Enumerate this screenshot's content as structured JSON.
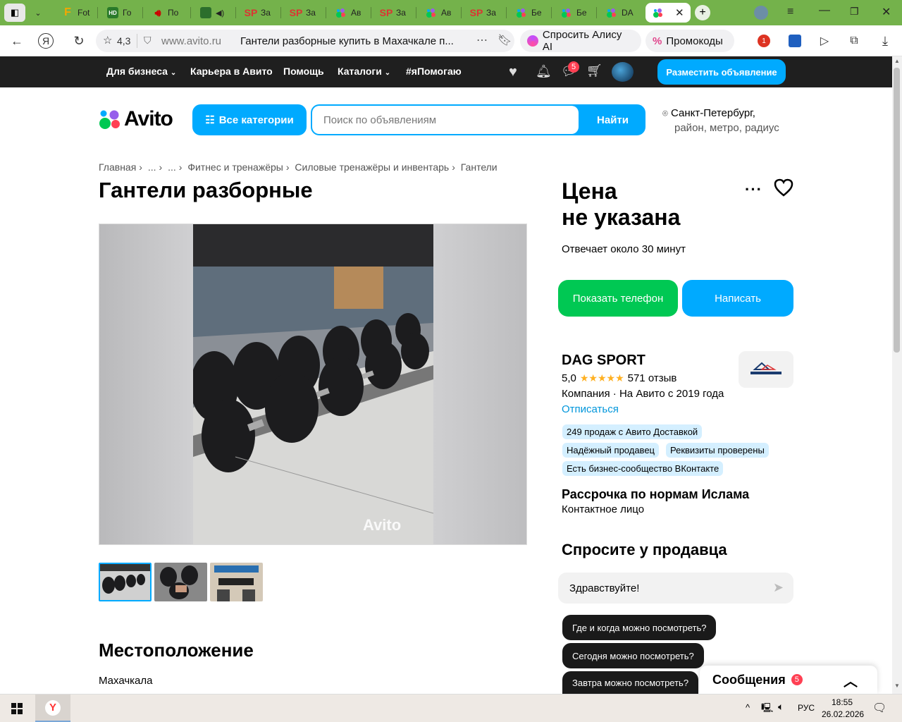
{
  "browser": {
    "tabs": [
      {
        "label": "Fot",
        "icon": "F"
      },
      {
        "label": "Го",
        "icon": "HD"
      },
      {
        "label": "По",
        "icon": "speaker"
      },
      {
        "label": "",
        "icon": "green"
      },
      {
        "label": "За",
        "icon": "SP"
      },
      {
        "label": "За",
        "icon": "SP"
      },
      {
        "label": "Ав",
        "icon": "avito"
      },
      {
        "label": "За",
        "icon": "SP"
      },
      {
        "label": "Ав",
        "icon": "avito"
      },
      {
        "label": "За",
        "icon": "SP"
      },
      {
        "label": "Бе",
        "icon": "avito"
      },
      {
        "label": "Бе",
        "icon": "avito"
      },
      {
        "label": "DA",
        "icon": "avito"
      }
    ],
    "rating": "4,3",
    "url_domain": "www.avito.ru",
    "page_title": "Гантели разборные купить в Махачкале п...",
    "alice_label": "Спросить Алису AI",
    "promo_label": "Промокоды",
    "ext_badge": "1"
  },
  "topnav": {
    "business": "Для бизнеса",
    "career": "Карьера в Авито",
    "help": "Помощь",
    "catalogs": "Каталоги",
    "help_tag": "#яПомогаю",
    "messages_count": "5",
    "post_button": "Разместить объявление"
  },
  "search": {
    "logo": "Avito",
    "categories_button": "Все категории",
    "placeholder": "Поиск по объявлениям",
    "find_button": "Найти",
    "location_city": "Санкт-Петербург,",
    "location_hint": "район, метро, радиус"
  },
  "breadcrumbs": [
    "Главная",
    "...",
    "...",
    "Фитнес и тренажёры",
    "Силовые тренажёры и инвентарь",
    "Гантели"
  ],
  "listing": {
    "title": "Гантели разборные",
    "watermark": "Avito",
    "location_heading": "Местоположение",
    "city": "Махачкала"
  },
  "sidebar": {
    "price_line1": "Цена",
    "price_line2": "не указана",
    "reply_time": "Отвечает около 30 минут",
    "phone_button": "Показать телефон",
    "write_button": "Написать",
    "seller_name": "DAG SPORT",
    "rating": "5,0",
    "reviews": "571 отзыв",
    "company": "Компания · На Авито с 2019 года",
    "unsubscribe": "Отписаться",
    "badges": [
      "249 продаж с Авито Доставкой",
      "Надёжный продавец",
      "Реквизиты проверены",
      "Есть бизнес-сообщество ВКонтакте"
    ],
    "installment": "Рассрочка по нормам Ислама",
    "contact_person": "Контактное лицо",
    "ask_heading": "Спросите у продавца",
    "ask_input": "Здравствуйте!",
    "quick_questions": [
      "Где и когда можно посмотреть?",
      "Сегодня можно посмотреть?",
      "Завтра можно посмотреть?"
    ],
    "messages_label": "Сообщения",
    "messages_count": "5"
  },
  "taskbar": {
    "lang": "РУС",
    "time": "18:55",
    "date": "26.02.2026"
  },
  "colors": {
    "accent": "#00aaff",
    "green": "#00c853",
    "badge": "#d4efff",
    "tabbar": "#74b24b"
  }
}
